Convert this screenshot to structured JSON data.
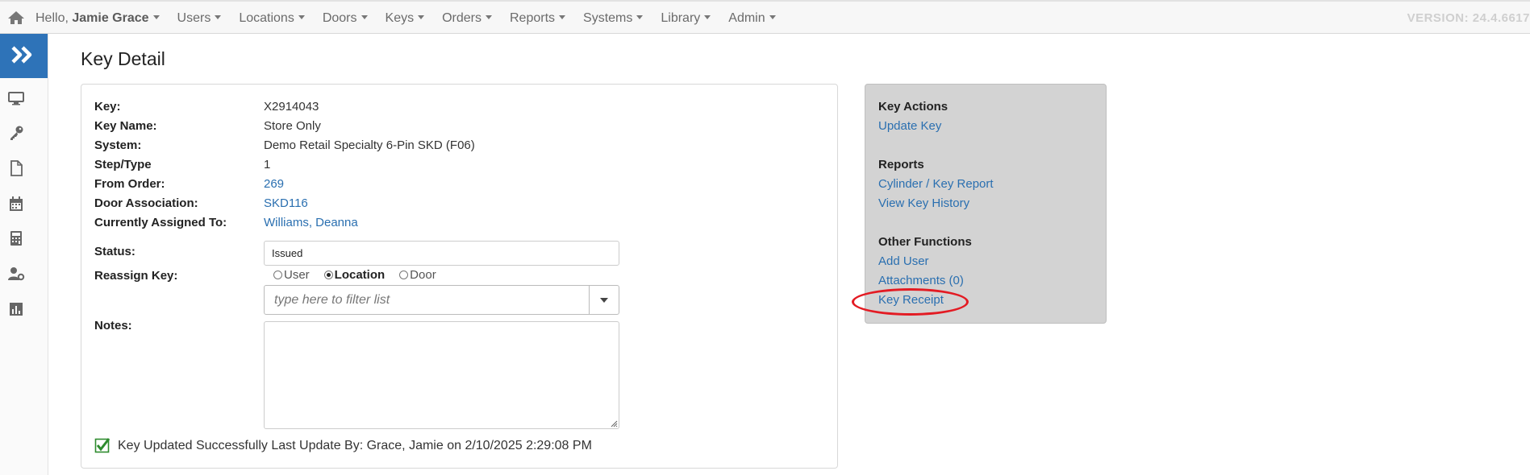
{
  "navbar": {
    "greeting_prefix": "Hello,",
    "user_name": "Jamie Grace",
    "items": [
      {
        "label": "Users"
      },
      {
        "label": "Locations"
      },
      {
        "label": "Doors"
      },
      {
        "label": "Keys"
      },
      {
        "label": "Orders"
      },
      {
        "label": "Reports"
      },
      {
        "label": "Systems"
      },
      {
        "label": "Library"
      },
      {
        "label": "Admin"
      }
    ],
    "version": "VERSION: 24.4.6617"
  },
  "sidebar": {
    "icons": [
      "double-chevron-right-icon",
      "monitor-icon",
      "key-icon",
      "document-icon",
      "calendar-icon",
      "calculator-icon",
      "user-settings-icon",
      "bar-chart-icon"
    ]
  },
  "page": {
    "title": "Key Detail"
  },
  "details": {
    "key_label": "Key:",
    "key_value": "X2914043",
    "key_name_label": "Key Name:",
    "key_name_value": "Store Only",
    "system_label": "System:",
    "system_value": "Demo Retail Specialty 6-Pin SKD (F06)",
    "step_type_label": "Step/Type",
    "step_type_value": "1",
    "from_order_label": "From Order:",
    "from_order_value": "269",
    "door_assoc_label": "Door Association:",
    "door_assoc_value": "SKD116",
    "assigned_label": "Currently Assigned To:",
    "assigned_value": "Williams, Deanna",
    "status_label": "Status:",
    "status_value": "Issued",
    "reassign_label": "Reassign Key:",
    "reassign_options": [
      {
        "label": "User",
        "selected": false
      },
      {
        "label": "Location",
        "selected": true
      },
      {
        "label": "Door",
        "selected": false
      }
    ],
    "filter_placeholder": "type here to filter list",
    "notes_label": "Notes:",
    "notes_value": "",
    "update_message": "Key Updated Successfully Last Update By: Grace, Jamie on 2/10/2025 2:29:08 PM"
  },
  "side_panel": {
    "key_actions_heading": "Key Actions",
    "update_key": "Update Key",
    "reports_heading": "Reports",
    "cylinder_key_report": "Cylinder / Key Report",
    "view_key_history": "View Key History",
    "other_functions_heading": "Other Functions",
    "add_user": "Add User",
    "attachments": "Attachments (0)",
    "key_receipt": "Key Receipt"
  },
  "colors": {
    "accent": "#2e73b8",
    "link": "#2a6fb0",
    "side_panel_bg": "#d3d3d3",
    "highlight": "#e31b23",
    "success": "#2e8b2e"
  }
}
